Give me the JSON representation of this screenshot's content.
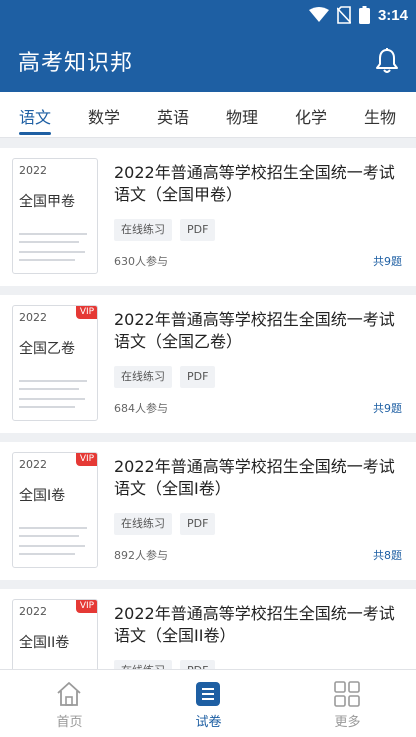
{
  "status_bar": {
    "time": "3:14"
  },
  "app": {
    "title": "高考知识邦"
  },
  "tabs": [
    {
      "label": "语文",
      "active": true
    },
    {
      "label": "数学"
    },
    {
      "label": "英语"
    },
    {
      "label": "物理"
    },
    {
      "label": "化学"
    },
    {
      "label": "生物"
    }
  ],
  "papers": [
    {
      "year": "2022",
      "thumb_name": "全国甲卷",
      "vip": false,
      "title": "2022年普通高等学校招生全国统一考试语文（全国甲卷）",
      "tags": [
        "在线练习",
        "PDF"
      ],
      "participants": "630人参与",
      "questions": "共9题"
    },
    {
      "year": "2022",
      "thumb_name": "全国乙卷",
      "vip": true,
      "vip_label": "VIP",
      "title": "2022年普通高等学校招生全国统一考试语文（全国乙卷）",
      "tags": [
        "在线练习",
        "PDF"
      ],
      "participants": "684人参与",
      "questions": "共9题"
    },
    {
      "year": "2022",
      "thumb_name": "全国I卷",
      "vip": true,
      "vip_label": "VIP",
      "title": "2022年普通高等学校招生全国统一考试语文（全国I卷）",
      "tags": [
        "在线练习",
        "PDF"
      ],
      "participants": "892人参与",
      "questions": "共8题"
    },
    {
      "year": "2022",
      "thumb_name": "全国II卷",
      "vip": true,
      "vip_label": "VIP",
      "title": "2022年普通高等学校招生全国统一考试语文（全国II卷）",
      "tags": [
        "在线练习",
        "PDF"
      ],
      "participants": "",
      "questions": ""
    }
  ],
  "bottom_nav": [
    {
      "label": "首页",
      "icon": "home-icon"
    },
    {
      "label": "试卷",
      "icon": "paper-list-icon",
      "active": true
    },
    {
      "label": "更多",
      "icon": "grid-icon"
    }
  ],
  "colors": {
    "primary": "#1e5fa3",
    "vip": "#e53935",
    "background": "#eef0f3"
  }
}
